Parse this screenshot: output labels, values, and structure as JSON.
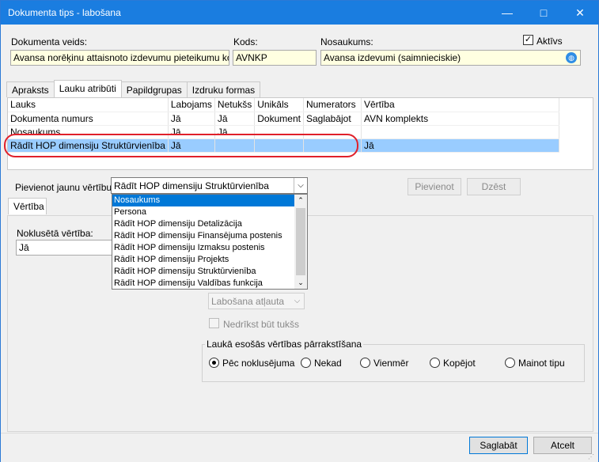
{
  "window": {
    "title": "Dokumenta tips - labošana"
  },
  "header": {
    "doc_type_label": "Dokumenta veids:",
    "doc_type_value": "Avansa norēķinu attaisnoto izdevumu pieteikumu komple",
    "code_label": "Kods:",
    "code_value": "AVNKP",
    "name_label": "Nosaukums:",
    "name_value": "Avansa izdevumi (saimnieciskie)",
    "active_label": "Aktīvs",
    "active_checked": true
  },
  "tabs": [
    "Apraksts",
    "Lauku atribūti",
    "Papildgrupas",
    "Izdruku formas"
  ],
  "grid": {
    "columns": [
      "Lauks",
      "Labojams",
      "Netukšs",
      "Unikāls",
      "Numerators",
      "Vērtība"
    ],
    "rows": [
      [
        "Dokumenta numurs",
        "Jā",
        "Jā",
        "Dokument",
        "Saglabājot",
        "AVN komplekts"
      ],
      [
        "Nosaukums",
        "Jā",
        "Jā",
        "",
        "",
        ""
      ],
      [
        "Rādīt HOP dimensiju Struktūrvienība",
        "Jā",
        "",
        "",
        "",
        "Jā"
      ]
    ]
  },
  "add_value": {
    "label": "Pievienot jaunu vērtību:",
    "selected": "Rādīt HOP dimensiju Struktūrvienība",
    "add_button": "Pievienot",
    "delete_button": "Dzēst",
    "options": [
      "Nosaukums",
      "Persona",
      "Rādīt HOP dimensiju Detalizācija",
      "Rādīt HOP dimensiju Finansējuma postenis",
      "Rādīt HOP dimensiju Izmaksu postenis",
      "Rādīt HOP dimensiju Projekts",
      "Rādīt HOP dimensiju Struktūrvienība",
      "Rādīt HOP dimensiju Valdības funkcija"
    ]
  },
  "value_tab": {
    "label": "Vērtība"
  },
  "value_panel": {
    "default_label": "Noklusētā vērtība:",
    "default_value": "Jā",
    "edit_allowed": "Labošana atļauta",
    "not_empty": "Nedrīkst būt tukšs",
    "overwrite_group": "Laukā esošās vērtības pārrakstīšana",
    "radios": [
      "Pēc noklusējuma",
      "Nekad",
      "Vienmēr",
      "Kopējot",
      "Mainot tipu"
    ]
  },
  "footer": {
    "save": "Saglabāt",
    "cancel": "Atcelt"
  },
  "colors": {
    "titlebar": "#1a7de0",
    "selection": "#99ccff",
    "highlight": "#0078d7",
    "annotation": "#e0202a"
  }
}
